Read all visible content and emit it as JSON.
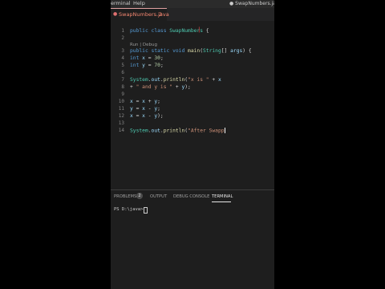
{
  "menubar": {
    "terminal_label": "erminal",
    "help_label": "Help",
    "window_title": "● SwapNumbers.java -"
  },
  "tab": {
    "label": "SwapNumbers.java",
    "problem_count": "2"
  },
  "editor": {
    "codelens": "Run | Debug",
    "lines": [
      {
        "num": "1",
        "t1": "public class ",
        "t2": "SwapNumbers",
        "t3": " {"
      },
      {
        "num": "2"
      },
      {
        "num": "3",
        "t1": "public static void ",
        "t2": "main",
        "t3": "(",
        "t4": "String",
        "t5": "[] ",
        "t6": "args",
        "t7": ") {"
      },
      {
        "num": "4",
        "t1": "int ",
        "t2": "x",
        "t3": " = ",
        "t4": "30",
        "t5": ";"
      },
      {
        "num": "5",
        "t1": "int ",
        "t2": "y",
        "t3": " = ",
        "t4": "70",
        "t5": ";"
      },
      {
        "num": "6"
      },
      {
        "num": "7",
        "t1": "System",
        "t2": ".",
        "t3": "out",
        "t4": ".",
        "t5": "println",
        "t6": "(",
        "t7": "\"x is \"",
        "t8": " + ",
        "t9": "x"
      },
      {
        "num": "8",
        "t1": "+ ",
        "t2": "\" and y is \"",
        "t3": " + ",
        "t4": "y",
        "t5": ");"
      },
      {
        "num": "9"
      },
      {
        "num": "10",
        "t1": "x",
        "t2": " = ",
        "t3": "x",
        "t4": " + ",
        "t5": "y",
        "t6": ";"
      },
      {
        "num": "11",
        "t1": "y",
        "t2": " = ",
        "t3": "x",
        "t4": " - ",
        "t5": "y",
        "t6": ";"
      },
      {
        "num": "12",
        "t1": "x",
        "t2": " = ",
        "t3": "x",
        "t4": " - ",
        "t5": "y",
        "t6": ");"
      },
      {
        "num": "13"
      },
      {
        "num": "14",
        "t1": "System",
        "t2": ".",
        "t3": "out",
        "t4": ".",
        "t5": "println",
        "t6": "(",
        "t7": "\"After Swapp"
      }
    ]
  },
  "panel": {
    "tabs": [
      "PROBLEMS",
      "OUTPUT",
      "DEBUG CONSOLE",
      "TERMINAL"
    ],
    "problems_badge": "2",
    "prompt": "PS D:\\java>"
  }
}
